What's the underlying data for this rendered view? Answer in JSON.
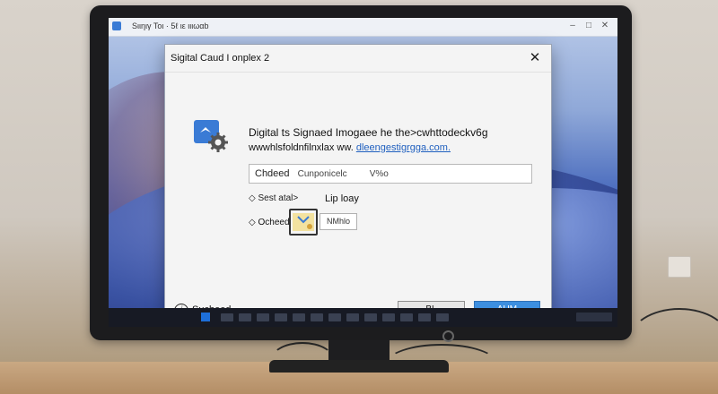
{
  "window": {
    "title": "Sιιηιγ Τοι · 5ℓ ιε ιιιωαb"
  },
  "dialog": {
    "title": "Sigital Caud I onplex 2",
    "close_glyph": "✕",
    "headline": "Digital ts Signaed Imogaee he the>cwhttodeckv6g",
    "subline_prefix": "wwwhlsfoldnfilnxlax ww. ",
    "subline_link": "dleengestigrgga.com.",
    "path_field": {
      "value": "Chdeed",
      "suffix": "Cunponicelc",
      "ext": "V%o"
    },
    "option1": {
      "label": "Sest atal>",
      "right_label": "Lip loay"
    },
    "option2": {
      "label": "Ocheed"
    },
    "small_field": "NMhlo",
    "help_label": "Sucbeed",
    "buttons": {
      "cancel": "BL",
      "ok": "AUM"
    }
  },
  "icons": [
    "app-icon",
    "close-icon",
    "signature-gear-icon",
    "radio-arrow-icon",
    "certificate-icon",
    "help-icon",
    "start-icon",
    "power-icon"
  ],
  "colors": {
    "accent": "#3d8fe0",
    "link": "#1f5fbf",
    "icon_blue": "#3a7bd5"
  }
}
